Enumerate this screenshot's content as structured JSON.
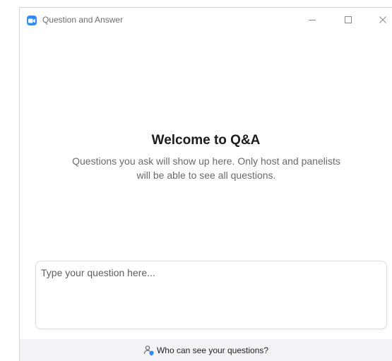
{
  "window": {
    "title": "Question and Answer",
    "app_icon": "zoom-camera-icon",
    "controls": {
      "minimize_icon": "minimize-icon",
      "maximize_icon": "maximize-icon",
      "close_icon": "close-icon"
    }
  },
  "welcome": {
    "title": "Welcome to Q&A",
    "description": "Questions you ask will show up here. Only host and panelists will be able to see all questions."
  },
  "question_input": {
    "placeholder": "Type your question here...",
    "value": ""
  },
  "footer": {
    "link_label": "Who can see your questions?",
    "icon": "user-shield-icon"
  },
  "colors": {
    "accent": "#2d8cff",
    "footer_bg": "#f3f3f6",
    "text_primary": "#1c1c1c",
    "text_secondary": "#6a6a6a"
  }
}
